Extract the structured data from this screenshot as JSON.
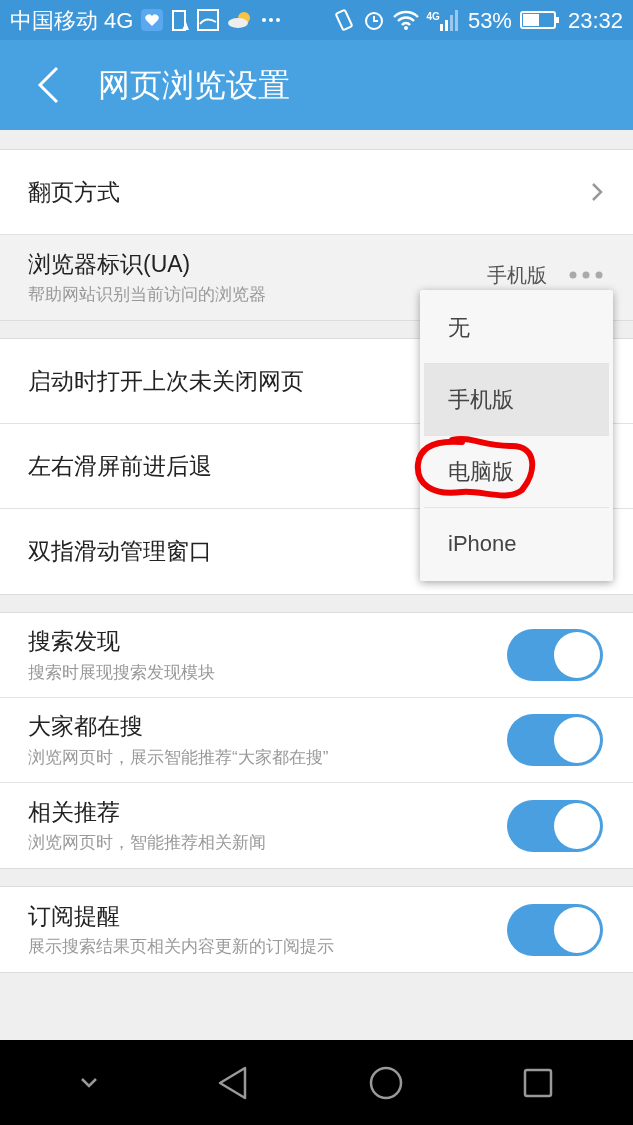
{
  "status_bar": {
    "carrier": "中国移动 4G",
    "network": "4G",
    "battery_text": "53%",
    "time": "23:32"
  },
  "header": {
    "title": "网页浏览设置"
  },
  "groups": [
    {
      "rows": [
        {
          "kind": "link",
          "title": "翻页方式",
          "pressed": false
        },
        {
          "kind": "value",
          "title": "浏览器标识(UA)",
          "subtitle": "帮助网站识别当前访问的浏览器",
          "value": "手机版",
          "pressed": true
        }
      ]
    },
    {
      "rows": [
        {
          "kind": "plain",
          "title": "启动时打开上次未关闭网页",
          "pressed": false
        },
        {
          "kind": "plain",
          "title": "左右滑屏前进后退",
          "pressed": false
        },
        {
          "kind": "plain",
          "title": "双指滑动管理窗口",
          "pressed": false
        }
      ]
    },
    {
      "rows": [
        {
          "kind": "toggle",
          "title": "搜索发现",
          "subtitle": "搜索时展现搜索发现模块",
          "on": true,
          "pressed": false
        },
        {
          "kind": "toggle",
          "title": "大家都在搜",
          "subtitle": "浏览网页时，展示智能推荐“大家都在搜”",
          "on": true,
          "pressed": false
        },
        {
          "kind": "toggle",
          "title": "相关推荐",
          "subtitle": "浏览网页时，智能推荐相关新闻",
          "on": true,
          "pressed": false
        }
      ]
    },
    {
      "rows": [
        {
          "kind": "toggle",
          "title": "订阅提醒",
          "subtitle": "展示搜索结果页相关内容更新的订阅提示",
          "on": true,
          "pressed": false
        }
      ]
    }
  ],
  "menu": {
    "items": [
      {
        "label": "无",
        "selected": false,
        "highlighted": false
      },
      {
        "label": "手机版",
        "selected": true,
        "highlighted": false
      },
      {
        "label": "电脑版",
        "selected": false,
        "highlighted": true
      },
      {
        "label": "iPhone",
        "selected": false,
        "highlighted": false
      }
    ]
  }
}
